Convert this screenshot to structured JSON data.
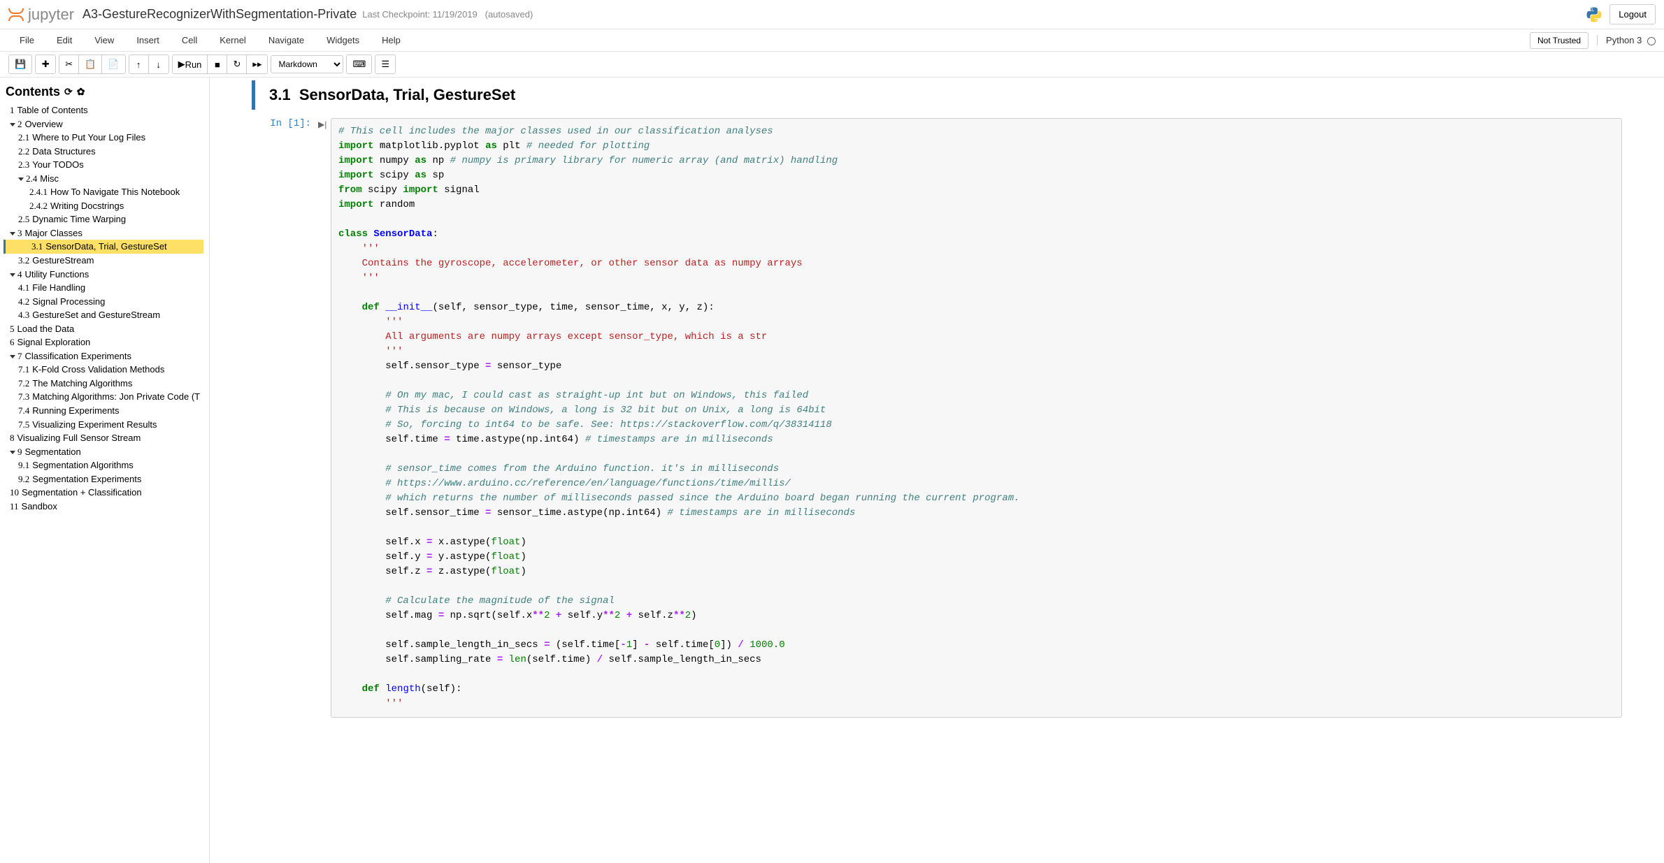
{
  "header": {
    "logo_text": "jupyter",
    "notebook_name": "A3-GestureRecognizerWithSegmentation-Private",
    "checkpoint": "Last Checkpoint: 11/19/2019",
    "autosave": "(autosaved)",
    "logout": "Logout"
  },
  "menubar": {
    "items": [
      "File",
      "Edit",
      "View",
      "Insert",
      "Cell",
      "Kernel",
      "Navigate",
      "Widgets",
      "Help"
    ],
    "not_trusted": "Not Trusted",
    "kernel": "Python 3"
  },
  "toolbar": {
    "run_label": "Run",
    "celltype": "Markdown"
  },
  "toc": {
    "title": "Contents",
    "items": [
      {
        "level": 1,
        "num": "1",
        "label": "Table of Contents",
        "caret": false
      },
      {
        "level": 1,
        "num": "2",
        "label": "Overview",
        "caret": true
      },
      {
        "level": 2,
        "num": "2.1",
        "label": "Where to Put Your Log Files"
      },
      {
        "level": 2,
        "num": "2.2",
        "label": "Data Structures"
      },
      {
        "level": 2,
        "num": "2.3",
        "label": "Your TODOs"
      },
      {
        "level": 2,
        "num": "2.4",
        "label": "Misc",
        "caret": true
      },
      {
        "level": 3,
        "num": "2.4.1",
        "label": "How To Navigate This Notebook"
      },
      {
        "level": 3,
        "num": "2.4.2",
        "label": "Writing Docstrings"
      },
      {
        "level": 2,
        "num": "2.5",
        "label": "Dynamic Time Warping"
      },
      {
        "level": 1,
        "num": "3",
        "label": "Major Classes",
        "caret": true
      },
      {
        "level": 2,
        "num": "3.1",
        "label": "SensorData, Trial, GestureSet",
        "active": true
      },
      {
        "level": 2,
        "num": "3.2",
        "label": "GestureStream"
      },
      {
        "level": 1,
        "num": "4",
        "label": "Utility Functions",
        "caret": true
      },
      {
        "level": 2,
        "num": "4.1",
        "label": "File Handling"
      },
      {
        "level": 2,
        "num": "4.2",
        "label": "Signal Processing"
      },
      {
        "level": 2,
        "num": "4.3",
        "label": "GestureSet and GestureStream"
      },
      {
        "level": 1,
        "num": "5",
        "label": "Load the Data"
      },
      {
        "level": 1,
        "num": "6",
        "label": "Signal Exploration"
      },
      {
        "level": 1,
        "num": "7",
        "label": "Classification Experiments",
        "caret": true
      },
      {
        "level": 2,
        "num": "7.1",
        "label": "K-Fold Cross Validation Methods"
      },
      {
        "level": 2,
        "num": "7.2",
        "label": "The Matching Algorithms"
      },
      {
        "level": 2,
        "num": "7.3",
        "label": "Matching Algorithms: Jon Private Code (T"
      },
      {
        "level": 2,
        "num": "7.4",
        "label": "Running Experiments"
      },
      {
        "level": 2,
        "num": "7.5",
        "label": "Visualizing Experiment Results"
      },
      {
        "level": 1,
        "num": "8",
        "label": "Visualizing Full Sensor Stream"
      },
      {
        "level": 1,
        "num": "9",
        "label": "Segmentation",
        "caret": true
      },
      {
        "level": 2,
        "num": "9.1",
        "label": "Segmentation Algorithms"
      },
      {
        "level": 2,
        "num": "9.2",
        "label": "Segmentation Experiments"
      },
      {
        "level": 1,
        "num": "10",
        "label": "Segmentation + Classification"
      },
      {
        "level": 1,
        "num": "11",
        "label": "Sandbox"
      }
    ]
  },
  "section": {
    "num": "3.1",
    "title": "SensorData, Trial, GestureSet"
  },
  "code": {
    "prompt": "In [1]:",
    "tokens": [
      {
        "t": "# This cell includes the major classes used in our classification analyses",
        "c": "c-comment"
      },
      {
        "t": "\n"
      },
      {
        "t": "import",
        "c": "c-keyword"
      },
      {
        "t": " matplotlib.pyplot "
      },
      {
        "t": "as",
        "c": "c-keyword"
      },
      {
        "t": " plt "
      },
      {
        "t": "# needed for plotting",
        "c": "c-comment"
      },
      {
        "t": "\n"
      },
      {
        "t": "import",
        "c": "c-keyword"
      },
      {
        "t": " numpy "
      },
      {
        "t": "as",
        "c": "c-keyword"
      },
      {
        "t": " np "
      },
      {
        "t": "# numpy is primary library for numeric array (and matrix) handling",
        "c": "c-comment"
      },
      {
        "t": "\n"
      },
      {
        "t": "import",
        "c": "c-keyword"
      },
      {
        "t": " scipy "
      },
      {
        "t": "as",
        "c": "c-keyword"
      },
      {
        "t": " sp\n"
      },
      {
        "t": "from",
        "c": "c-keyword"
      },
      {
        "t": " scipy "
      },
      {
        "t": "import",
        "c": "c-keyword"
      },
      {
        "t": " signal\n"
      },
      {
        "t": "import",
        "c": "c-keyword"
      },
      {
        "t": " random\n\n"
      },
      {
        "t": "class",
        "c": "c-keyword"
      },
      {
        "t": " "
      },
      {
        "t": "SensorData",
        "c": "c-def"
      },
      {
        "t": ":\n    "
      },
      {
        "t": "'''",
        "c": "c-string"
      },
      {
        "t": "\n    "
      },
      {
        "t": "Contains the gyroscope, accelerometer, or other sensor data as numpy arrays",
        "c": "c-string"
      },
      {
        "t": "\n    "
      },
      {
        "t": "'''",
        "c": "c-string"
      },
      {
        "t": "\n       \n    "
      },
      {
        "t": "def",
        "c": "c-keyword"
      },
      {
        "t": " "
      },
      {
        "t": "__init__",
        "c": "c-name"
      },
      {
        "t": "(self, sensor_type, time, sensor_time, x, y, z):\n        "
      },
      {
        "t": "'''",
        "c": "c-string"
      },
      {
        "t": "\n        "
      },
      {
        "t": "All arguments are numpy arrays except sensor_type, which is a str",
        "c": "c-string"
      },
      {
        "t": "\n        "
      },
      {
        "t": "'''",
        "c": "c-string"
      },
      {
        "t": "\n        self.sensor_type "
      },
      {
        "t": "=",
        "c": "c-op"
      },
      {
        "t": " sensor_type\n        \n        "
      },
      {
        "t": "# On my mac, I could cast as straight-up int but on Windows, this failed",
        "c": "c-comment"
      },
      {
        "t": "\n        "
      },
      {
        "t": "# This is because on Windows, a long is 32 bit but on Unix, a long is 64bit",
        "c": "c-comment"
      },
      {
        "t": "\n        "
      },
      {
        "t": "# So, forcing to int64 to be safe. See: https://stackoverflow.com/q/38314118",
        "c": "c-comment"
      },
      {
        "t": "\n        self.time "
      },
      {
        "t": "=",
        "c": "c-op"
      },
      {
        "t": " time.astype(np.int64) "
      },
      {
        "t": "# timestamps are in milliseconds",
        "c": "c-comment"
      },
      {
        "t": "\n        \n        "
      },
      {
        "t": "# sensor_time comes from the Arduino function. it's in milliseconds",
        "c": "c-comment"
      },
      {
        "t": "\n        "
      },
      {
        "t": "# https://www.arduino.cc/reference/en/language/functions/time/millis/",
        "c": "c-comment"
      },
      {
        "t": "\n        "
      },
      {
        "t": "# which returns the number of milliseconds passed since the Arduino board began running the current program.",
        "c": "c-comment"
      },
      {
        "t": "\n        self.sensor_time "
      },
      {
        "t": "=",
        "c": "c-op"
      },
      {
        "t": " sensor_time.astype(np.int64) "
      },
      {
        "t": "# timestamps are in milliseconds",
        "c": "c-comment"
      },
      {
        "t": "\n        \n        self.x "
      },
      {
        "t": "=",
        "c": "c-op"
      },
      {
        "t": " x.astype("
      },
      {
        "t": "float",
        "c": "c-builtin"
      },
      {
        "t": ")\n        self.y "
      },
      {
        "t": "=",
        "c": "c-op"
      },
      {
        "t": " y.astype("
      },
      {
        "t": "float",
        "c": "c-builtin"
      },
      {
        "t": ")\n        self.z "
      },
      {
        "t": "=",
        "c": "c-op"
      },
      {
        "t": " z.astype("
      },
      {
        "t": "float",
        "c": "c-builtin"
      },
      {
        "t": ")\n        \n        "
      },
      {
        "t": "# Calculate the magnitude of the signal",
        "c": "c-comment"
      },
      {
        "t": "\n        self.mag "
      },
      {
        "t": "=",
        "c": "c-op"
      },
      {
        "t": " np.sqrt(self.x"
      },
      {
        "t": "**",
        "c": "c-op"
      },
      {
        "t": "2",
        "c": "c-num"
      },
      {
        "t": " "
      },
      {
        "t": "+",
        "c": "c-op"
      },
      {
        "t": " self.y"
      },
      {
        "t": "**",
        "c": "c-op"
      },
      {
        "t": "2",
        "c": "c-num"
      },
      {
        "t": " "
      },
      {
        "t": "+",
        "c": "c-op"
      },
      {
        "t": " self.z"
      },
      {
        "t": "**",
        "c": "c-op"
      },
      {
        "t": "2",
        "c": "c-num"
      },
      {
        "t": ")\n        \n        self.sample_length_in_secs "
      },
      {
        "t": "=",
        "c": "c-op"
      },
      {
        "t": " (self.time["
      },
      {
        "t": "-",
        "c": "c-op"
      },
      {
        "t": "1",
        "c": "c-num"
      },
      {
        "t": "] "
      },
      {
        "t": "-",
        "c": "c-op"
      },
      {
        "t": " self.time["
      },
      {
        "t": "0",
        "c": "c-num"
      },
      {
        "t": "]) "
      },
      {
        "t": "/",
        "c": "c-op"
      },
      {
        "t": " "
      },
      {
        "t": "1000.0",
        "c": "c-num"
      },
      {
        "t": "\n        self.sampling_rate "
      },
      {
        "t": "=",
        "c": "c-op"
      },
      {
        "t": " "
      },
      {
        "t": "len",
        "c": "c-builtin"
      },
      {
        "t": "(self.time) "
      },
      {
        "t": "/",
        "c": "c-op"
      },
      {
        "t": " self.sample_length_in_secs\n        \n    "
      },
      {
        "t": "def",
        "c": "c-keyword"
      },
      {
        "t": " "
      },
      {
        "t": "length",
        "c": "c-name"
      },
      {
        "t": "(self):\n        "
      },
      {
        "t": "'''",
        "c": "c-string"
      }
    ]
  }
}
